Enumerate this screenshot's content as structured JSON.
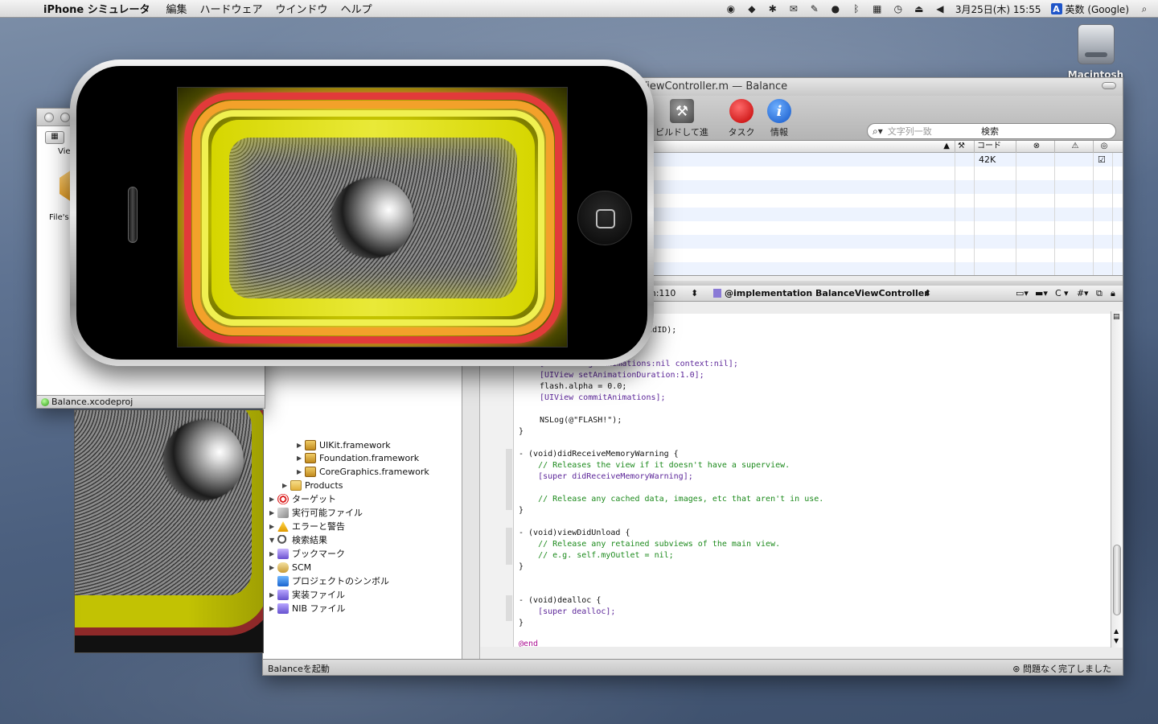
{
  "menubar": {
    "app_name": "iPhone シミュレータ",
    "items": [
      "編集",
      "ハードウェア",
      "ウインドウ",
      "ヘルプ"
    ],
    "datetime": "3月25日(木) 15:55",
    "input_badge": "A",
    "input_method": "英数 (Google)"
  },
  "desktop": {
    "hd_label": "Macintosh HD"
  },
  "xcode": {
    "title": "BalanceViewController.m — Balance",
    "toolbar": {
      "build_go": "ビルドして進行",
      "task": "タスク",
      "info": "情報",
      "search_placeholder": "文字列一致",
      "search_label": "検索"
    },
    "detail": {
      "col_code": "コード",
      "rows": [
        {
          "code": "42K",
          "checked": true
        },
        {
          "code": ""
        },
        {
          "code": ""
        },
        {
          "code": ""
        },
        {
          "code": ""
        },
        {
          "code": ""
        },
        {
          "code": ""
        },
        {
          "code": ""
        },
        {
          "code": ""
        }
      ]
    },
    "editor_nav": {
      "line": "m:110",
      "symbol": "@implementation BalanceViewController",
      "c_label": "C",
      "hash_label": "#"
    },
    "groups": {
      "items": [
        {
          "label": "UIKit.framework"
        },
        {
          "label": "Foundation.framework"
        },
        {
          "label": "CoreGraphics.framework"
        },
        {
          "label": "Products"
        },
        {
          "label": "ターゲット"
        },
        {
          "label": "実行可能ファイル"
        },
        {
          "label": "エラーと警告"
        },
        {
          "label": "検索結果"
        },
        {
          "label": "ブックマーク"
        },
        {
          "label": "SCM"
        },
        {
          "label": "プロジェクトのシンボル"
        },
        {
          "label": "実装ファイル"
        },
        {
          "label": "NIB ファイル"
        }
      ]
    },
    "code": {
      "lines": [
        "ound(soundID);",
        "",
        "",
        "[UIView beginAnimations:nil context:nil];",
        "[UIView setAnimationDuration:1.0];",
        "flash.alpha = 0.0;",
        "[UIView commitAnimations];",
        "",
        "NSLog(@\"FLASH!\");",
        "}",
        "",
        "- (void)didReceiveMemoryWarning {",
        "    // Releases the view if it doesn't have a superview.",
        "    [super didReceiveMemoryWarning];",
        "",
        "    // Release any cached data, images, etc that aren't in use.",
        "}",
        "",
        "- (void)viewDidUnload {",
        "    // Release any retained subviews of the main view.",
        "    // e.g. self.myOutlet = nil;",
        "}",
        "",
        "",
        "- (void)dealloc {",
        "    [super dealloc];",
        "}",
        "",
        "@end"
      ]
    },
    "status_left": "Balanceを起動",
    "status_right": "問題なく完了しました"
  },
  "ibdoc": {
    "toolbar_label": "Vie",
    "files_owner": "File's",
    "status": "Balance.xcodeproj"
  },
  "colors": {
    "ring_red": "#e23a3a",
    "ring_orange": "#f0a020",
    "ring_yellow": "#e5e500",
    "accent_blue": "#1f55c9"
  }
}
